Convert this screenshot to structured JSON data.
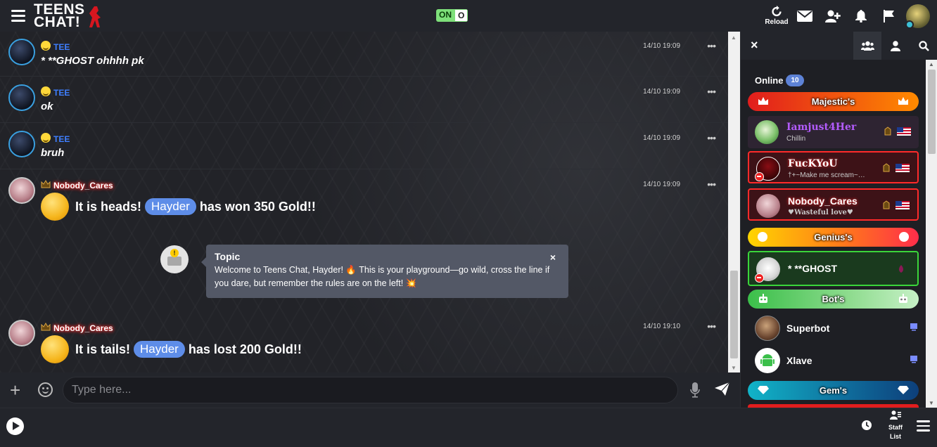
{
  "header": {
    "logo_line1": "TEENS",
    "logo_line2": "CHAT!",
    "toggle_on": "ON",
    "toggle_off": "O",
    "reload_label": "Reload"
  },
  "messages": [
    {
      "user": "TEE",
      "text": "* **GHOST ohhhh pk",
      "time": "14/10 19:09"
    },
    {
      "user": "TEE",
      "text": "ok",
      "time": "14/10 19:09"
    },
    {
      "user": "TEE",
      "text": "bruh",
      "time": "14/10 19:09"
    },
    {
      "user": "Nobody_Cares",
      "pre": "It is heads!",
      "player": "Hayder",
      "post": "has won 350 Gold!!",
      "time": "14/10 19:09"
    },
    {
      "user": "Nobody_Cares",
      "pre": "It is tails!",
      "player": "Hayder",
      "post": "has lost 200 Gold!!",
      "time": "14/10 19:10"
    }
  ],
  "more_glyph": "•••",
  "topic": {
    "title": "Topic",
    "body": "Welcome to Teens Chat, Hayder! 🔥 This is your playground—go wild, cross the line if you dare, but remember the rules are on the left! 💥",
    "close": "×"
  },
  "input": {
    "placeholder": "Type here..."
  },
  "sidebar": {
    "close": "×",
    "online_label": "Online",
    "online_count": "10",
    "bands": [
      {
        "label": "Majestic's",
        "gradient": [
          "#e11d1d",
          "#ff8a00"
        ]
      },
      {
        "label": "Genius's",
        "gradient": [
          "#ffd500",
          "#ff2d4a"
        ]
      },
      {
        "label": "Bot's",
        "gradient": [
          "#3bbf4a",
          "#c6f0c6"
        ]
      },
      {
        "label": "Gem's",
        "gradient": [
          "#11b4c8",
          "#0d3f7a"
        ]
      }
    ],
    "users": [
      {
        "name": "Iamjust4Her",
        "mood": "Chillin",
        "color": "#b45cff"
      },
      {
        "name": "FucKYoU",
        "mood": "†+~Make me scream~…",
        "color": "#ffffff"
      },
      {
        "name": "Nobody_Cares",
        "mood": "♥Wasteful love♥",
        "color": "#ffffff"
      },
      {
        "name": "* **GHOST",
        "mood": "",
        "color": "#ffffff"
      },
      {
        "name": "Superbot",
        "mood": "",
        "color": "#ffffff"
      },
      {
        "name": "Xlave",
        "mood": "",
        "color": "#ffffff"
      }
    ]
  },
  "footer": {
    "staff_label_1": "Staff",
    "staff_label_2": "List"
  },
  "colors": {
    "name_blue": "#3f7fff",
    "pill": "#5e8de8",
    "topic_bg": "#535866",
    "toggle_green": "#7ee07a"
  }
}
